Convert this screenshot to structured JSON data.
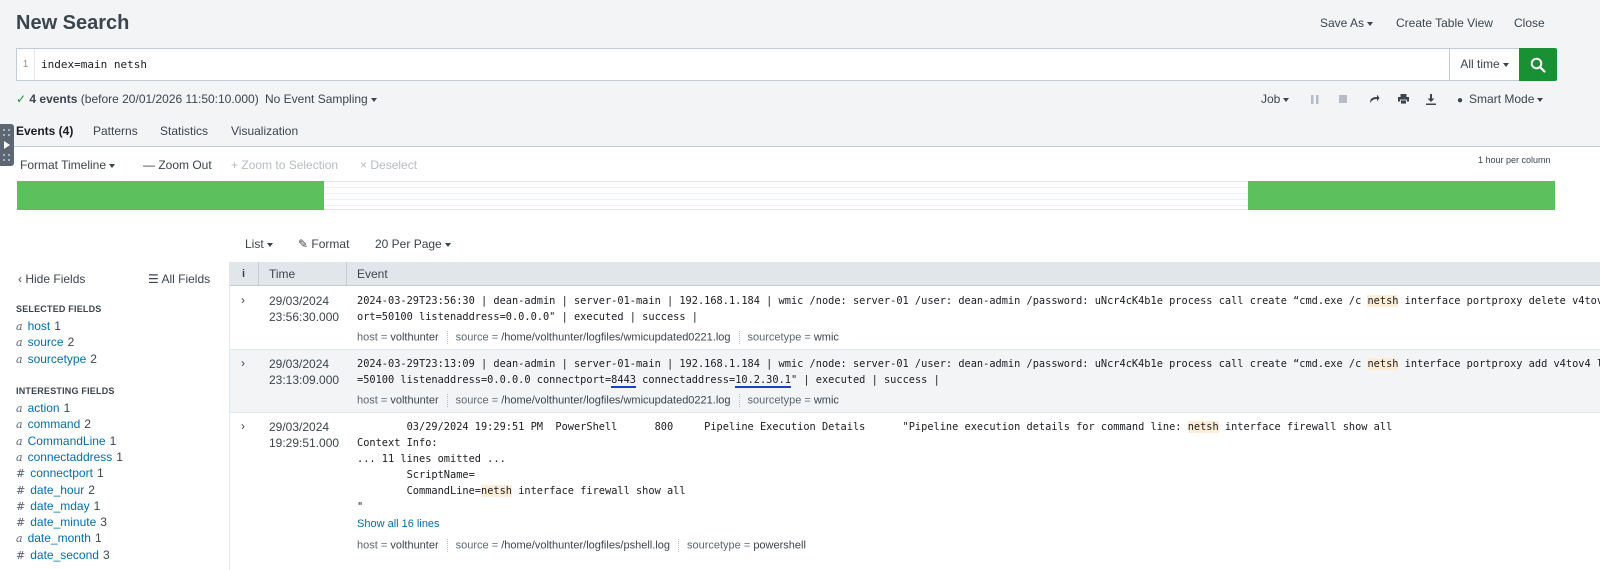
{
  "header": {
    "title": "New Search",
    "save_as": "Save As",
    "create_table_view": "Create Table View",
    "close": "Close"
  },
  "search": {
    "line_number": "1",
    "query": "index=main netsh",
    "time_range": "All time"
  },
  "status": {
    "event_count": "4 events",
    "before_text": "(before 20/01/2026 11:50:10.000)",
    "sampling": "No Event Sampling",
    "job": "Job",
    "mode": "Smart Mode"
  },
  "tabs": [
    {
      "label": "Events (4)",
      "active": true
    },
    {
      "label": "Patterns"
    },
    {
      "label": "Statistics"
    },
    {
      "label": "Visualization"
    }
  ],
  "timeline": {
    "format": "Format Timeline",
    "zoom_out": "Zoom Out",
    "zoom_selection": "Zoom to Selection",
    "deselect": "Deselect",
    "per_column": "1 hour per column"
  },
  "results_toolbar": {
    "list": "List",
    "format": "Format",
    "per_page": "20 Per Page"
  },
  "fields_panel": {
    "hide_fields": "Hide Fields",
    "all_fields": "All Fields",
    "selected_heading": "SELECTED FIELDS",
    "interesting_heading": "INTERESTING FIELDS",
    "selected": [
      {
        "type": "a",
        "name": "host",
        "count": "1"
      },
      {
        "type": "a",
        "name": "source",
        "count": "2"
      },
      {
        "type": "a",
        "name": "sourcetype",
        "count": "2"
      }
    ],
    "interesting": [
      {
        "type": "a",
        "name": "action",
        "count": "1"
      },
      {
        "type": "a",
        "name": "command",
        "count": "2"
      },
      {
        "type": "a",
        "name": "CommandLine",
        "count": "1"
      },
      {
        "type": "a",
        "name": "connectaddress",
        "count": "1"
      },
      {
        "type": "#",
        "name": "connectport",
        "count": "1"
      },
      {
        "type": "#",
        "name": "date_hour",
        "count": "2"
      },
      {
        "type": "#",
        "name": "date_mday",
        "count": "1"
      },
      {
        "type": "#",
        "name": "date_minute",
        "count": "3"
      },
      {
        "type": "a",
        "name": "date_month",
        "count": "1"
      },
      {
        "type": "#",
        "name": "date_second",
        "count": "3"
      }
    ]
  },
  "events_table": {
    "info_col": "i",
    "time_col": "Time",
    "event_col": "Event",
    "rows": [
      {
        "date": "29/03/2024",
        "time": "23:56:30.000",
        "line1_pre": "2024-03-29T23:56:30 | dean-admin | server-01-main | 192.168.1.184 | wmic /node: server-01 /user: dean-admin /password: uNcr4cK4b1e process call create “cmd.exe /c ",
        "line1_hl": "netsh",
        "line1_post": " interface portproxy delete v4tov4 listenp",
        "line2": "ort=50100 listenaddress=0.0.0.0\" | executed | success |",
        "host": "volthunter",
        "source": "/home/volthunter/logfiles/wmicupdated0221.log",
        "sourcetype": "wmic"
      },
      {
        "date": "29/03/2024",
        "time": "23:13:09.000",
        "line1_pre": "2024-03-29T23:13:09 | dean-admin | server-01-main | 192.168.1.184 | wmic /node: server-01 /user: dean-admin /password: uNcr4cK4b1e process call create “cmd.exe /c ",
        "line1_hl": "netsh",
        "line1_post": " interface portproxy add v4tov4 listenport",
        "line2_a": "=50100 listenaddress=0.0.0.0 connectport=",
        "line2_port": "8443",
        "line2_b": " connectaddress=",
        "line2_addr": "10.2.30.1",
        "line2_c": "\" | executed | success |",
        "host": "volthunter",
        "source": "/home/volthunter/logfiles/wmicupdated0221.log",
        "sourcetype": "wmic"
      },
      {
        "date": "29/03/2024",
        "time": "19:29:51.000",
        "line1_pre": "        03/29/2024 19:29:51 PM  PowerShell      800     Pipeline Execution Details      \"Pipeline execution details for command line: ",
        "line1_hl": "netsh",
        "line1_post": " interface firewall show all",
        "line2": "Context Info:",
        "line3": "... 11 lines omitted ...",
        "line4": "        ScriptName=",
        "line5_pre": "        CommandLine=",
        "line5_hl": "netsh",
        "line5_post": " interface firewall show all",
        "line6": "\"",
        "show_all": "Show all 16 lines",
        "host": "volthunter",
        "source": "/home/volthunter/logfiles/pshell.log",
        "sourcetype": "powershell"
      }
    ]
  },
  "meta_labels": {
    "host": "host = ",
    "source": "source = ",
    "sourcetype": "sourcetype = "
  },
  "colors": {
    "accent_green": "#1a9035",
    "timeline_bar": "#5cc05c",
    "link_blue": "#006eaa",
    "highlight": "#fdedd6"
  }
}
